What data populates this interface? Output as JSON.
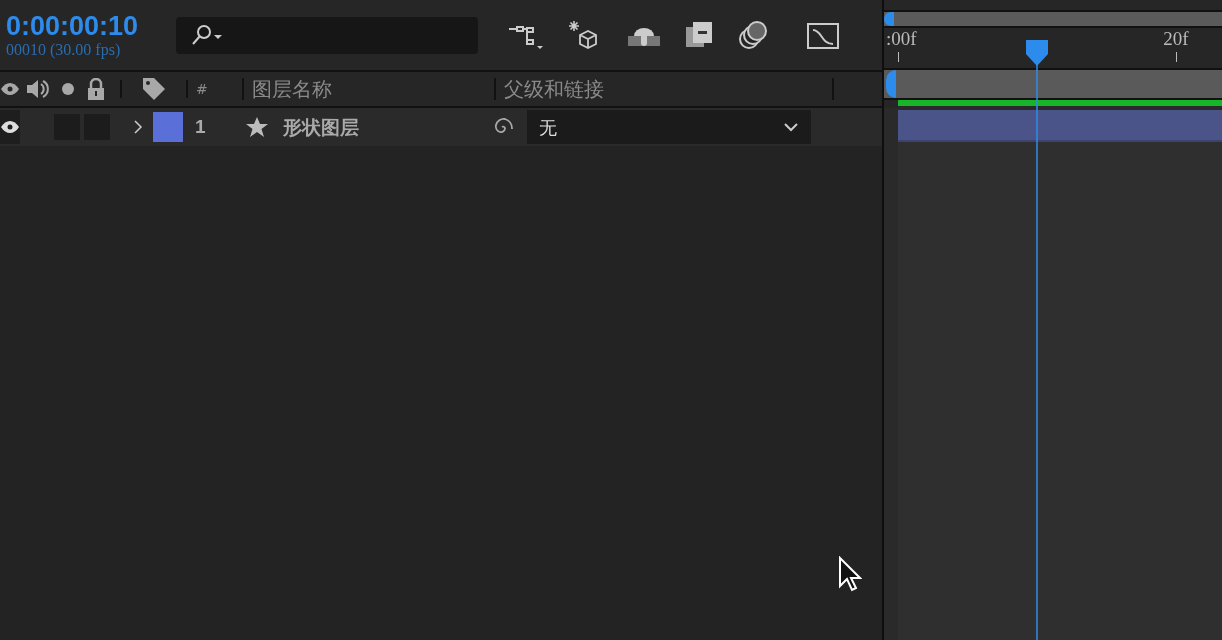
{
  "timecode": "0:00:00:10",
  "frame_info": "00010 (30.00 fps)",
  "columns": {
    "number": "#",
    "layer_name": "图层名称",
    "parent": "父级和链接"
  },
  "layers": [
    {
      "number": "1",
      "name": "形状图层",
      "visible": true,
      "expanded": false,
      "color": "#5a6fd8",
      "parent": "无"
    }
  ],
  "ruler": [
    ":00f",
    "20f"
  ]
}
